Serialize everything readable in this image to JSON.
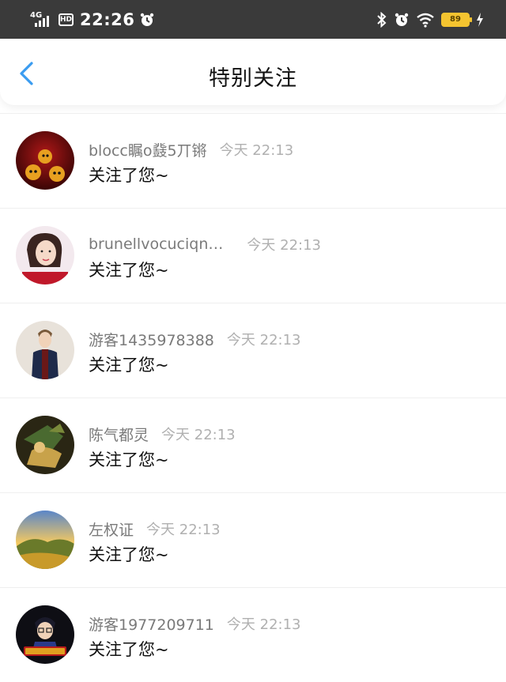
{
  "status_bar": {
    "network": "4G",
    "hd": "HD",
    "time": "22:26",
    "battery": "89"
  },
  "nav": {
    "title": "特别关注"
  },
  "items": [
    {
      "name": "blocc瞩o鼗5丌锵",
      "time": "今天 22:13",
      "message": "关注了您~"
    },
    {
      "name": "brunellvocuciqn…",
      "time": "今天 22:13",
      "message": "关注了您~"
    },
    {
      "name": "游客1435978388",
      "time": "今天 22:13",
      "message": "关注了您~"
    },
    {
      "name": "陈气都灵",
      "time": "今天 22:13",
      "message": "关注了您~"
    },
    {
      "name": "左权证",
      "time": "今天 22:13",
      "message": "关注了您~"
    },
    {
      "name": "游客1977209711",
      "time": "今天 22:13",
      "message": "关注了您~"
    }
  ],
  "colors": {
    "accent": "#3a9cf0",
    "status_bar_bg": "#3a3a3a",
    "battery": "#f4c430"
  }
}
